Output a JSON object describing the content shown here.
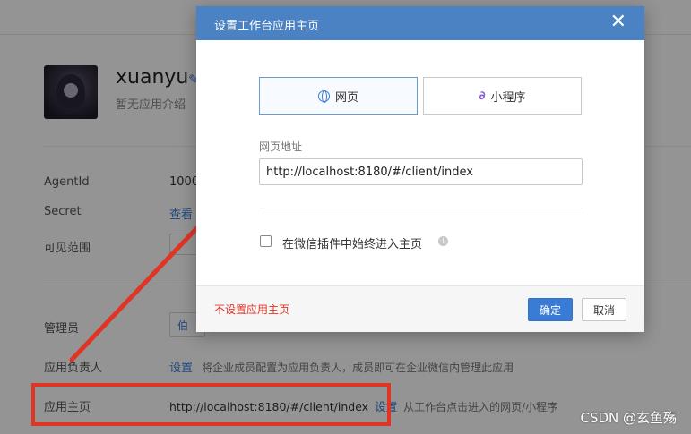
{
  "app": {
    "name": "xuanyu",
    "description": "暂无应用介绍"
  },
  "details": {
    "agentid_label": "AgentId",
    "agentid_value": "1000",
    "secret_label": "Secret",
    "secret_value": "查看",
    "visible_label": "可见范围",
    "visible_value": "设",
    "admin_label": "管理员",
    "admin_value": "伯",
    "owner_label": "应用负责人",
    "owner_link": "设置",
    "owner_hint": "将企业成员配置为应用负责人，成员即可在企业微信内管理此应用",
    "home_label": "应用主页",
    "home_url": "http://localhost:8180/#/client/index",
    "home_link": "设置",
    "home_hint": "从工作台点击进入的网页/小程序"
  },
  "modal": {
    "title": "设置工作台应用主页",
    "close": "✕",
    "tabs": [
      {
        "label": "网页",
        "active": true
      },
      {
        "label": "小程序",
        "active": false
      }
    ],
    "mini_icon": "∂",
    "field_label": "网页地址",
    "url_value": "http://localhost:8180/#/client/index",
    "checkbox_label": "在微信插件中始终进入主页",
    "checkbox_checked": false,
    "info_icon": "i",
    "no_home_link": "不设置应用主页",
    "ok_label": "确定",
    "cancel_label": "取消"
  },
  "watermark": "CSDN @玄鱼殇",
  "colors": {
    "header": "#4a82c3",
    "primary": "#3a7bd5",
    "annotation_red": "#e03425"
  }
}
